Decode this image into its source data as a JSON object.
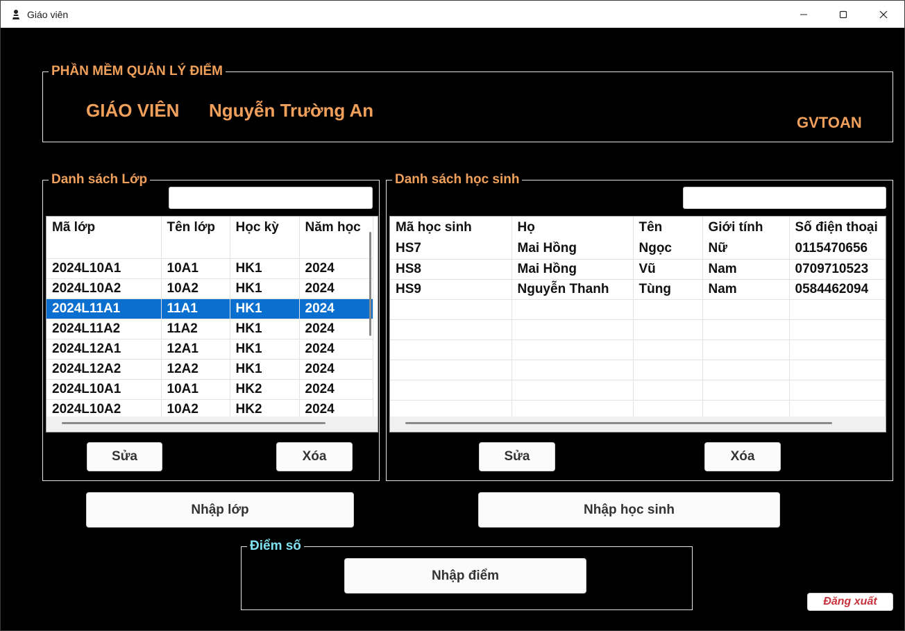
{
  "window": {
    "title": "Giáo viên"
  },
  "header": {
    "legend": "PHẦN MỀM QUẢN LÝ ĐIỂM",
    "teacher_label": "GIÁO VIÊN",
    "teacher_name": "Nguyễn Trường An",
    "teacher_code": "GVTOAN"
  },
  "class_list": {
    "legend": "Danh sách Lớp",
    "search_value": "",
    "columns": [
      "Mã lớp",
      "Tên lớp",
      "Học kỳ",
      "Năm học"
    ],
    "rows": [
      [
        "",
        "",
        "",
        ""
      ],
      [
        "2024L10A1",
        "10A1",
        "HK1",
        "2024"
      ],
      [
        "2024L10A2",
        "10A2",
        "HK1",
        "2024"
      ],
      [
        "2024L11A1",
        "11A1",
        "HK1",
        "2024"
      ],
      [
        "2024L11A2",
        "11A2",
        "HK1",
        "2024"
      ],
      [
        "2024L12A1",
        "12A1",
        "HK1",
        "2024"
      ],
      [
        "2024L12A2",
        "12A2",
        "HK1",
        "2024"
      ],
      [
        "2024L10A1",
        "10A1",
        "HK2",
        "2024"
      ],
      [
        "2024L10A2",
        "10A2",
        "HK2",
        "2024"
      ]
    ],
    "edit_label": "Sửa",
    "delete_label": "Xóa",
    "import_label": "Nhập lớp"
  },
  "student_list": {
    "legend": "Danh sách học sinh",
    "search_value": "",
    "columns": [
      "Mã học sinh",
      "Họ",
      "Tên",
      "Giới tính",
      "Số điện thoại"
    ],
    "rows": [
      [
        "HS7",
        "Mai Hồng",
        "Ngọc",
        "Nữ",
        "0115470656"
      ],
      [
        "HS8",
        "Mai Hồng",
        "Vũ",
        "Nam",
        "0709710523"
      ],
      [
        "HS9",
        "Nguyễn Thanh",
        "Tùng",
        "Nam",
        "0584462094"
      ],
      [
        "",
        "",
        "",
        "",
        ""
      ],
      [
        "",
        "",
        "",
        "",
        ""
      ],
      [
        "",
        "",
        "",
        "",
        ""
      ],
      [
        "",
        "",
        "",
        "",
        ""
      ],
      [
        "",
        "",
        "",
        "",
        ""
      ],
      [
        "",
        "",
        "",
        "",
        ""
      ]
    ],
    "edit_label": "Sửa",
    "delete_label": "Xóa",
    "import_label": "Nhập học sinh"
  },
  "scores": {
    "legend": "Điểm số",
    "import_label": "Nhập điểm"
  },
  "logout_label": "Đăng xuất"
}
